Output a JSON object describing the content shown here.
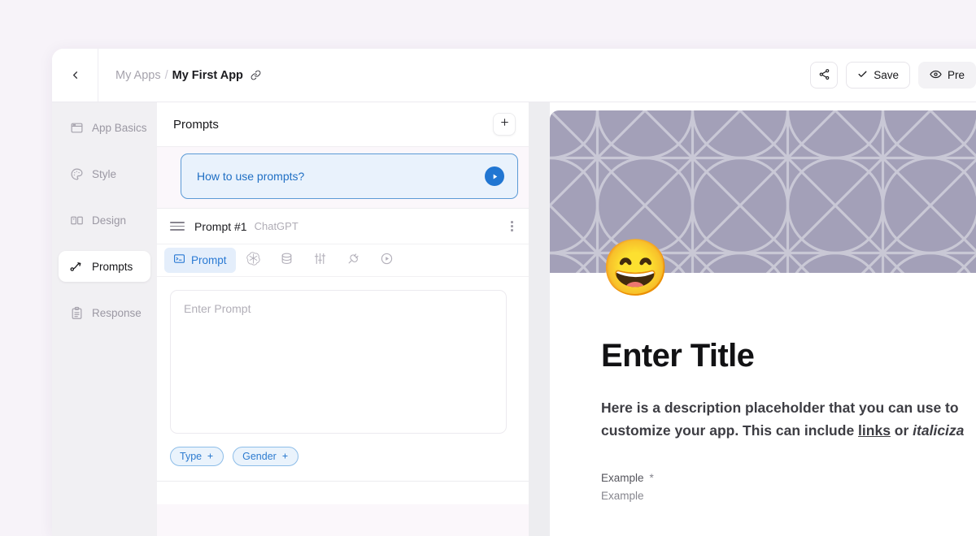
{
  "window": {
    "background_color": "#f7f3f9"
  },
  "topbar": {
    "back_icon": "chevron-left-icon",
    "breadcrumb": {
      "root": "My Apps",
      "separator": "/",
      "current": "My First App",
      "link_icon": "link-icon"
    },
    "actions": [
      {
        "name": "share-button",
        "icon": "share-icon",
        "label": ""
      },
      {
        "name": "save-button",
        "icon": "check-icon",
        "label": "Save"
      },
      {
        "name": "preview-button",
        "icon": "eye-icon",
        "label": "Pre"
      }
    ]
  },
  "sidebar": {
    "items": [
      {
        "label": "App Basics",
        "icon": "window-icon",
        "active": false
      },
      {
        "label": "Style",
        "icon": "palette-icon",
        "active": false
      },
      {
        "label": "Design",
        "icon": "layout-icon",
        "active": false
      },
      {
        "label": "Prompts",
        "icon": "prompt-flow-icon",
        "active": true
      },
      {
        "label": "Response",
        "icon": "clipboard-icon",
        "active": false
      }
    ]
  },
  "prompts_panel": {
    "title": "Prompts",
    "add_button_label": "+",
    "banner": {
      "text": "How to use prompts?",
      "play_icon": "play-circle-icon",
      "border_color": "#5b9ad6",
      "background_color": "#e9f2fc",
      "text_color": "#1f6fc4"
    },
    "card": {
      "drag_handle_icon": "drag-handle-icon",
      "title": "Prompt #1",
      "model": "ChatGPT",
      "menu_icon": "more-vertical-icon",
      "tabs": [
        {
          "label": "Prompt",
          "icon": "terminal-icon",
          "active": true
        },
        {
          "label": "",
          "icon": "openai-icon",
          "active": false
        },
        {
          "label": "",
          "icon": "database-icon",
          "active": false
        },
        {
          "label": "",
          "icon": "sliders-icon",
          "active": false
        },
        {
          "label": "",
          "icon": "plug-icon",
          "active": false
        },
        {
          "label": "",
          "icon": "play-circle-icon",
          "active": false
        }
      ],
      "textarea_placeholder": "Enter Prompt",
      "textarea_value": "",
      "chips": [
        {
          "label": "Type",
          "add_icon": "plus-icon"
        },
        {
          "label": "Gender",
          "add_icon": "plus-icon"
        }
      ]
    }
  },
  "preview": {
    "banner_color": "#a3a0b8",
    "emoji": "😄",
    "title": "Enter Title",
    "description_part1": "Here is a description placeholder that you can use to",
    "description_part2_a": "customize your app. This can include ",
    "description_link": "links",
    "description_part2_b": " or ",
    "description_italic": "italiciza",
    "field_label": "Example",
    "field_required_marker": "*",
    "field_value": "Example"
  }
}
